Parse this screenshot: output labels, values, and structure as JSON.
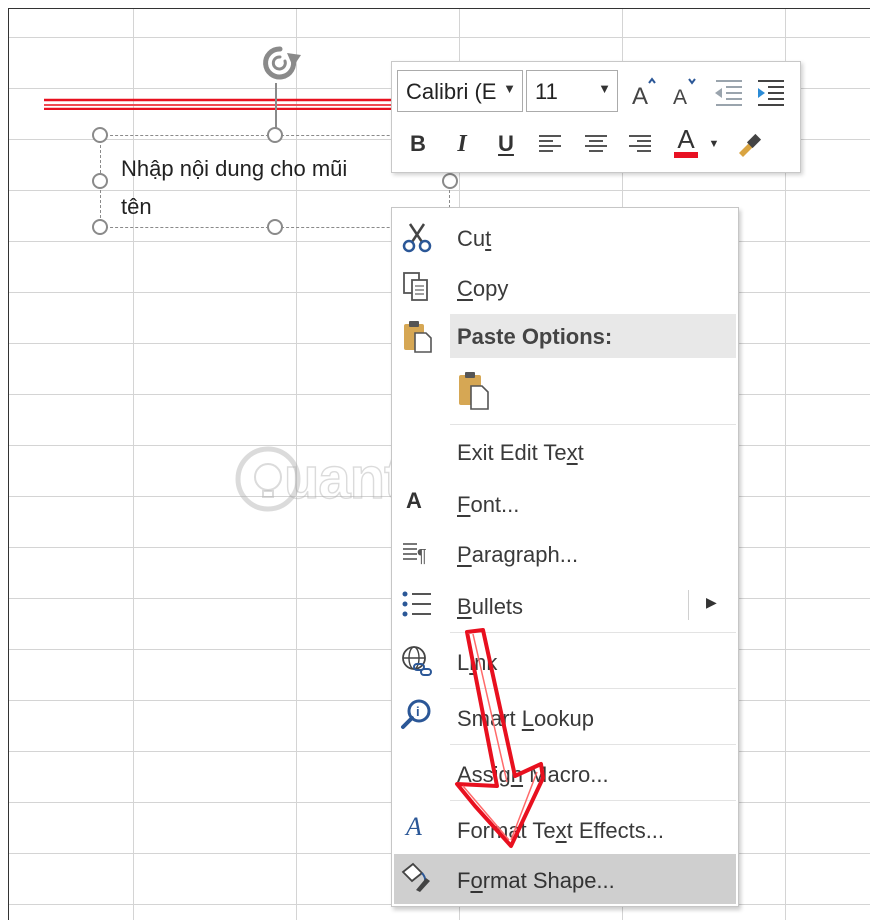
{
  "textbox": {
    "line1": "Nhập nội dung cho mũi",
    "line2": "tên"
  },
  "mini_toolbar": {
    "font_name": "Calibri (E",
    "font_size": "11",
    "bold": "B",
    "italic": "I",
    "underline": "U",
    "font_color_letter": "A",
    "grow_font_letter": "A",
    "shrink_font_letter": "A",
    "font_color_hex": "#e81123"
  },
  "context_menu": {
    "cut": {
      "pre": "Cu",
      "key": "t",
      "post": ""
    },
    "copy": {
      "pre": "",
      "key": "C",
      "post": "opy"
    },
    "paste_options": "Paste Options:",
    "exit_edit_text": {
      "pre": "Exit Edit Te",
      "key": "x",
      "post": "t"
    },
    "font": {
      "pre": "",
      "key": "F",
      "post": "ont..."
    },
    "paragraph": {
      "pre": "",
      "key": "P",
      "post": "aragraph..."
    },
    "bullets": {
      "pre": "",
      "key": "B",
      "post": "ullets"
    },
    "link": {
      "pre": "L",
      "key": "i",
      "post": "nk"
    },
    "smart_lookup": {
      "pre": "Smart ",
      "key": "L",
      "post": "ookup"
    },
    "assign_macro": {
      "pre": "Assig",
      "key": "n",
      "post": " Macro..."
    },
    "format_text_effects": {
      "pre": "Format Te",
      "key": "x",
      "post": "t Effects..."
    },
    "format_shape": {
      "pre": "F",
      "key": "o",
      "post": "rmat Shape..."
    },
    "font_icon_letter": "A"
  },
  "watermark": {
    "text": "uantrimang"
  },
  "colors": {
    "accent_red": "#e8101f",
    "menu_highlight": "#cfcfcf",
    "icon_blue": "#2b5797"
  }
}
